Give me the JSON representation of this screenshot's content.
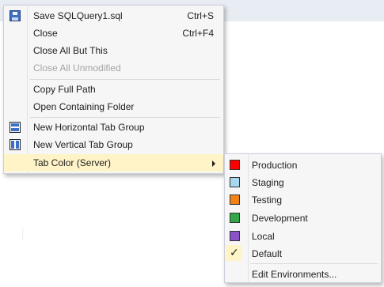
{
  "colors": {
    "menu_background": "#f6f6f6",
    "highlight": "#fff4c8",
    "disabled_text": "#a2a4a5",
    "production": "#ff0000",
    "staging": "#a8d8f0",
    "testing": "#f08418",
    "development": "#33a64a",
    "local": "#8a53c8"
  },
  "context_menu": {
    "items": [
      {
        "label": "Save SQLQuery1.sql",
        "shortcut": "Ctrl+S",
        "icon": "save-icon"
      },
      {
        "label": "Close",
        "shortcut": "Ctrl+F4"
      },
      {
        "label": "Close All But This"
      },
      {
        "label": "Close All Unmodified",
        "disabled": true
      },
      {
        "label": "Copy Full Path"
      },
      {
        "label": "Open Containing Folder"
      },
      {
        "label": "New Horizontal Tab Group",
        "icon": "horizontal-tab-group-icon"
      },
      {
        "label": "New Vertical Tab Group",
        "icon": "vertical-tab-group-icon"
      },
      {
        "label": "Tab Color (Server)",
        "has_submenu": true,
        "highlighted": true
      }
    ]
  },
  "tab_color_submenu": {
    "items": [
      {
        "label": "Production",
        "color": "#ff0000"
      },
      {
        "label": "Staging",
        "color": "#a8d8f0"
      },
      {
        "label": "Testing",
        "color": "#f08418"
      },
      {
        "label": "Development",
        "color": "#33a64a"
      },
      {
        "label": "Local",
        "color": "#8a53c8"
      },
      {
        "label": "Default",
        "checked": true,
        "check_glyph": "✓"
      },
      {
        "label": "Edit Environments..."
      }
    ]
  }
}
